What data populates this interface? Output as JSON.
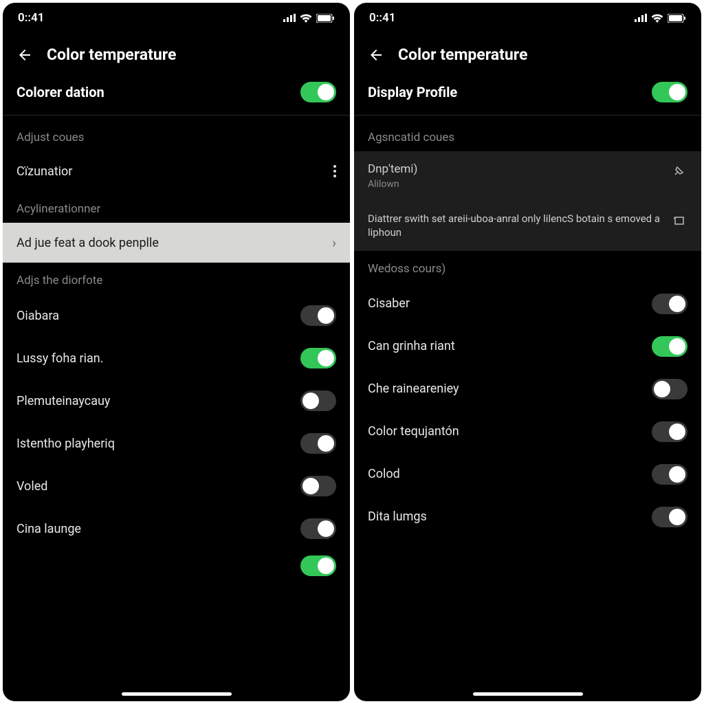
{
  "status": {
    "time": "0::41"
  },
  "colors": {
    "accent_on": "#33c759"
  },
  "left": {
    "title": "Color temperature",
    "main_toggle": {
      "label": "Colorer dation",
      "on": true
    },
    "section1": "Adjust coues",
    "row_civ": "Cïzunatior",
    "section2": "Acylinerationner",
    "row_highlight": "Ad jue feat a dook penplle",
    "section3": "Adjs the diorfote",
    "toggles": [
      {
        "label": "Oiabara",
        "on": false,
        "knob": "right"
      },
      {
        "label": "Lussy foha rian.",
        "on": true,
        "knob": "right"
      },
      {
        "label": "Plemuteinaycauy",
        "on": false,
        "knob": "left"
      },
      {
        "label": "Istentho playheriq",
        "on": false,
        "knob": "right"
      },
      {
        "label": "Voled",
        "on": false,
        "knob": "left"
      },
      {
        "label": "Cina launge",
        "on": false,
        "knob": "right"
      }
    ],
    "peek": {
      "on": true
    }
  },
  "right": {
    "title": "Color temperature",
    "main_toggle": {
      "label": "Display Profile",
      "on": true
    },
    "section1": "Agsncatid coues",
    "block_row1_label": "Dnp'temi)",
    "block_row1_sub": "Alilown",
    "block_row2_label": "Diattrer swith set areii-uboa-anral only lilencS botain s emoved a liphoun",
    "section2": "Wedoss cours)",
    "toggles": [
      {
        "label": "Cisaber",
        "on": false,
        "knob": "right"
      },
      {
        "label": "Can grinha riant",
        "on": true,
        "knob": "right"
      },
      {
        "label": "Che raineareniey",
        "on": false,
        "knob": "left"
      },
      {
        "label": "Color tequjantón",
        "on": false,
        "knob": "right"
      },
      {
        "label": "Colod",
        "on": false,
        "knob": "right"
      },
      {
        "label": "Dita lumgs",
        "on": false,
        "knob": "right"
      }
    ]
  }
}
